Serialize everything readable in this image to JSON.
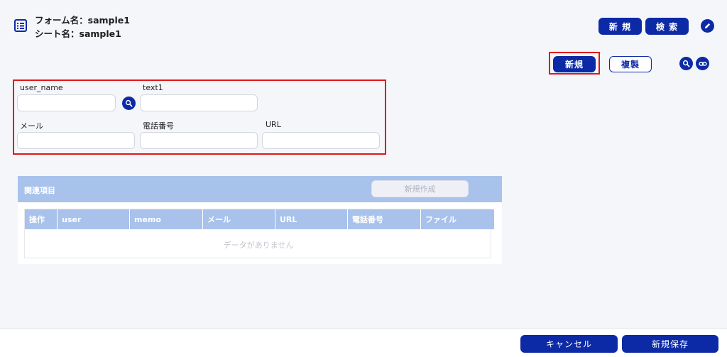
{
  "header": {
    "form_name": "フォーム名：sample1",
    "sheet_name": "シート名：sample1",
    "new_label": "新 規",
    "search_label": "検 索"
  },
  "toolbar": {
    "new_label": "新規",
    "duplicate_label": "複製"
  },
  "form": {
    "fields": [
      {
        "label": "user_name",
        "value": ""
      },
      {
        "label": "text1",
        "value": ""
      },
      {
        "label": "メール",
        "value": ""
      },
      {
        "label": "電話番号",
        "value": ""
      },
      {
        "label": "URL",
        "value": ""
      }
    ]
  },
  "related": {
    "title": "関連項目",
    "create_label": "新規作成",
    "columns": [
      "操作",
      "user",
      "memo",
      "メール",
      "URL",
      "電話番号",
      "ファイル"
    ],
    "empty_text": "データがありません"
  },
  "footer": {
    "cancel_label": "キャンセル",
    "save_label": "新規保存"
  },
  "colors": {
    "primary": "#0d2aa6",
    "highlight": "#e01818",
    "table_header": "#a8c2ec"
  }
}
